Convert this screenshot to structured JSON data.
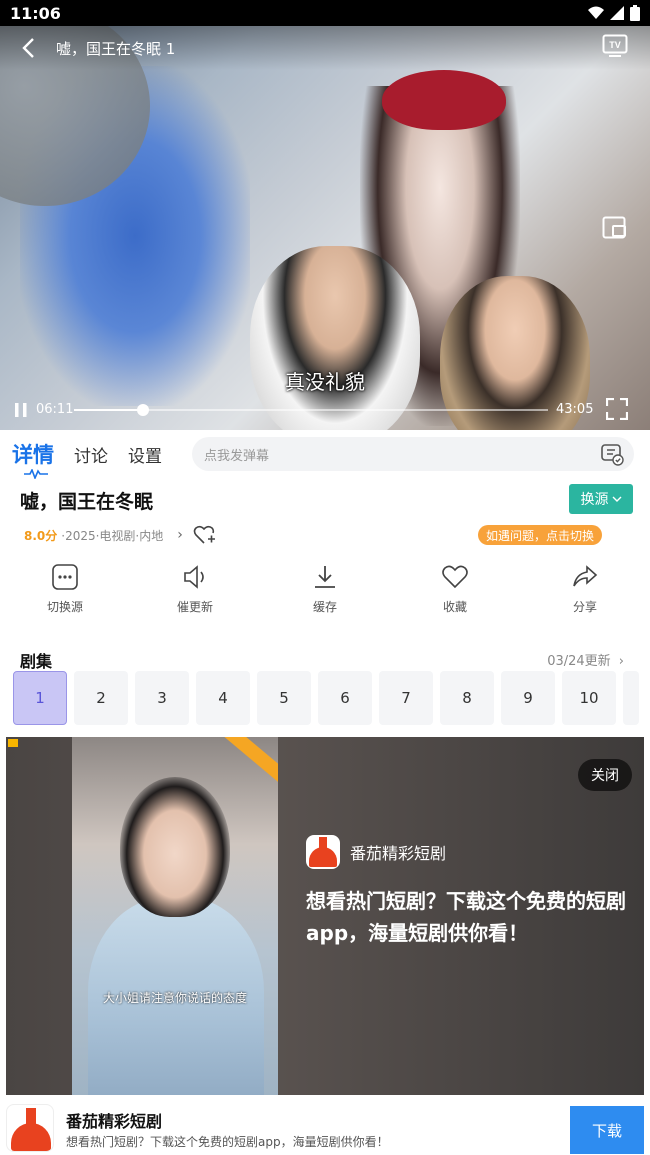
{
  "status_bar": {
    "time": "11:06"
  },
  "player": {
    "title": "嘘，国王在冬眠 1",
    "subtitle": "真没礼貌",
    "current_time": "06:11",
    "total_time": "43:05",
    "progress": 0.145
  },
  "tabs": [
    {
      "label": "详情"
    },
    {
      "label": "讨论"
    },
    {
      "label": "设置"
    }
  ],
  "danmu": {
    "placeholder": "点我发弹幕"
  },
  "show": {
    "title": "嘘，国王在冬眠",
    "switch_source": "换源",
    "score": "8.0分",
    "meta": "·2025·电视剧·内地",
    "problem_hint": "如遇问题，点击切换"
  },
  "actions": [
    {
      "label": "切换源",
      "icon": "more-icon"
    },
    {
      "label": "催更新",
      "icon": "speaker-icon"
    },
    {
      "label": "缓存",
      "icon": "download-icon"
    },
    {
      "label": "收藏",
      "icon": "heart-icon"
    },
    {
      "label": "分享",
      "icon": "share-icon"
    }
  ],
  "episodes": {
    "title": "剧集",
    "update": "03/24更新",
    "items": [
      "1",
      "2",
      "3",
      "4",
      "5",
      "6",
      "7",
      "8",
      "9",
      "10"
    ],
    "selected": "1"
  },
  "ad": {
    "close": "关闭",
    "brand": "番茄精彩短剧",
    "headline": "想看热门短剧？下载这个免费的短剧app，海量短剧供你看！",
    "poster_caption": "大小姐请注意你说话的态度"
  },
  "bottom_banner": {
    "name": "番茄精彩短剧",
    "desc": "想看热门短剧？下载这个免费的短剧app，海量短剧供你看！",
    "download": "下载"
  },
  "colors": {
    "accent": "#1a73e8",
    "switch_source": "#2bb5a0",
    "score": "#f29a1a",
    "hint_pill": "#f8a23a",
    "download": "#2e8cf0"
  }
}
